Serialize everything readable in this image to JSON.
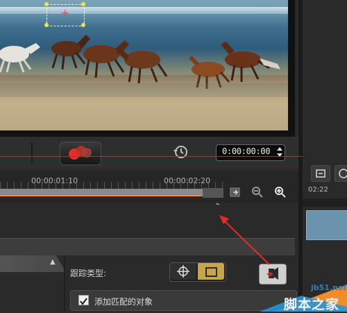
{
  "player": {
    "timecode": "0:00:00:00"
  },
  "ruler": {
    "labels": [
      "00:00:01:10",
      "00:00:02:20"
    ]
  },
  "right_panel": {
    "time_label": "02:22"
  },
  "tracking": {
    "type_label": "跟踪类型:",
    "add_matched_object_label": "添加匹配的对象",
    "add_matched_object_checked": true
  },
  "watermark": {
    "site": "jb51.net",
    "name": "脚本之家"
  },
  "colors": {
    "accent_orange": "#f08a2a",
    "selected_button": "#c8a44a",
    "playhead_red": "#d02323",
    "watermark_blue": "#2f7fc4"
  },
  "icons": {
    "history": "history-icon",
    "zoom_out": "zoom-out-icon",
    "zoom_in": "zoom-in-icon",
    "track_point": "crosshair-icon",
    "track_area": "area-box-icon"
  }
}
